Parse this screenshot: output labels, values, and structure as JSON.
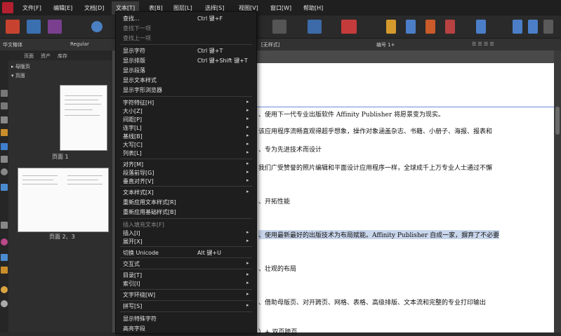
{
  "menubar": {
    "items": [
      {
        "label": "文件[F]"
      },
      {
        "label": "编辑[E]"
      },
      {
        "label": "文档[D]"
      },
      {
        "label": "文本[T]"
      },
      {
        "label": "表[B]"
      },
      {
        "label": "图层[L]"
      },
      {
        "label": "选择[S]"
      },
      {
        "label": "视图[V]"
      },
      {
        "label": "窗口[W]"
      },
      {
        "label": "帮助[H]"
      }
    ]
  },
  "context_bar": {
    "font_family": "华文楷体",
    "font_style": "Regular",
    "para_style": "[无样式]",
    "list_style": "编号 1+"
  },
  "pages_panel": {
    "tabs": [
      "页面",
      "资产",
      "库存"
    ],
    "section_masters": "母版页",
    "section_pages": "页面",
    "page1_label": "页面 1",
    "page23_label": "页面 2、3"
  },
  "document": {
    "lines": [
      "、使用下一代专业出版软件 Affinity Publisher 将愿景变为现实。",
      "该应用程序流畅直观得超乎想象，操作对象涵盖杂志、书籍、小册子、海报、报表和",
      "、专为先进技术而设计",
      "我们广受赞誉的照片编辑和平面设计应用程序一样，全球成千上万专业人士通过不懈",
      "、开拓性能",
      "、使用最新最好的出版技术为布局赋能。Affinity Publisher 自成一家，摒弃了不必要",
      "、壮观的布局",
      "、借助母版页、对开跨页、网格、表格、高级排版、文本流和完整的专业打印输出",
      "）+ 双页跨页"
    ]
  },
  "text_menu": {
    "items": [
      {
        "label": "查找...",
        "shortcut": "Ctrl 键+F"
      },
      {
        "label": "查找下一项"
      },
      {
        "label": "查找上一项"
      },
      {
        "label": "显示字符",
        "shortcut": "Ctrl 键+T"
      },
      {
        "label": "显示排版",
        "shortcut": "Ctrl 键+Shift 键+T"
      },
      {
        "label": "显示段落"
      },
      {
        "label": "显示文本样式"
      },
      {
        "label": "显示字形浏览器"
      },
      {
        "label": "字符特征[H]"
      },
      {
        "label": "大小[Z]"
      },
      {
        "label": "间距[P]"
      },
      {
        "label": "连字[L]"
      },
      {
        "label": "基线[B]"
      },
      {
        "label": "大写[C]"
      },
      {
        "label": "列表[L]"
      },
      {
        "label": "对齐[M]"
      },
      {
        "label": "段落前导[G]"
      },
      {
        "label": "垂直对齐[V]"
      },
      {
        "label": "文本样式[X]"
      },
      {
        "label": "重新应用文本样式[R]"
      },
      {
        "label": "重新应用基础样式[B]"
      },
      {
        "label": "插入填充文本[F]"
      },
      {
        "label": "插入[I]"
      },
      {
        "label": "展开[X]"
      },
      {
        "label": "切换 Unicode",
        "shortcut": "Alt 键+U"
      },
      {
        "label": "交互式"
      },
      {
        "label": "目录[T]"
      },
      {
        "label": "索引[I]"
      },
      {
        "label": "文字环绕[W]"
      },
      {
        "label": "拼写[S]"
      },
      {
        "label": "显示特殊字符"
      },
      {
        "label": "高亮字段"
      }
    ]
  },
  "colors": {
    "menubar_bg": "#1f1f1f",
    "menu_bg": "#1e1e1e",
    "canvas_bg": "#4a4a4a",
    "highlight": "#c9d6ec",
    "brand": "#b4202f"
  }
}
